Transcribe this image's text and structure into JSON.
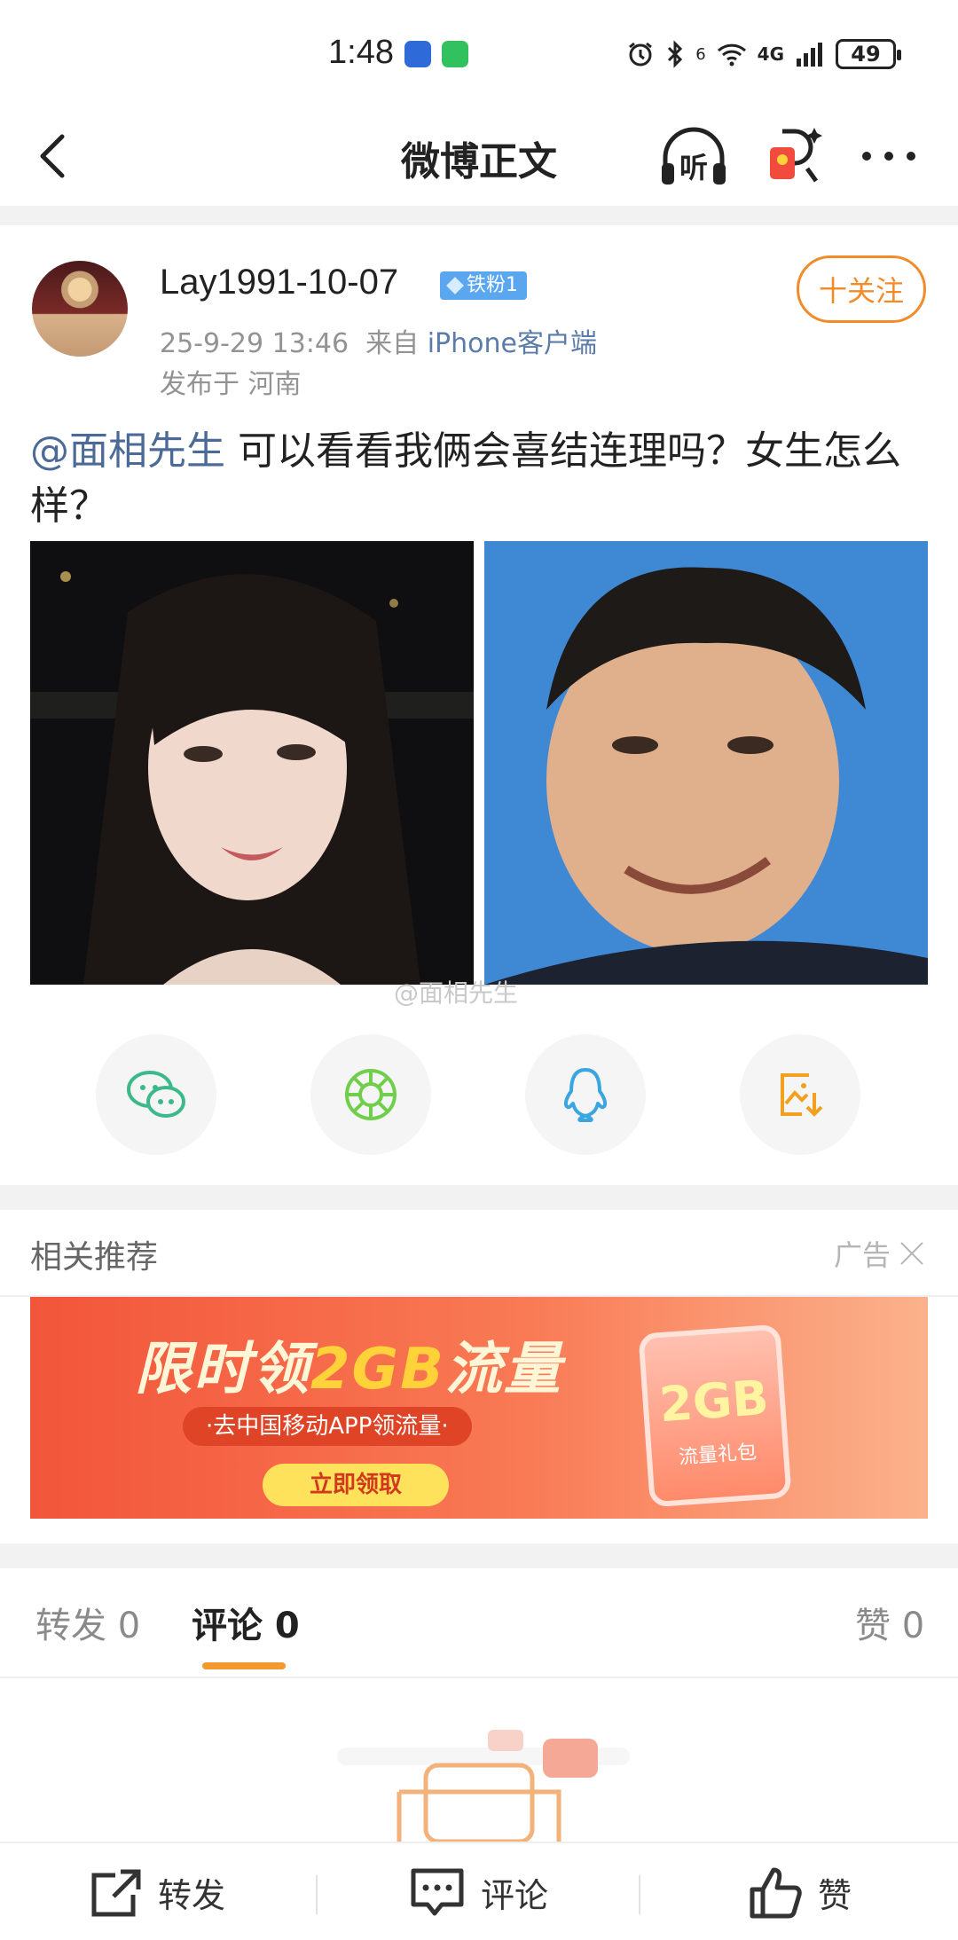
{
  "status_bar": {
    "time": "1:48",
    "network": "4G",
    "signal_prefix": "6",
    "battery": "49"
  },
  "nav": {
    "title": "微博正文",
    "listen_label": "听"
  },
  "post": {
    "author": "Lay1991-10-07",
    "fan_badge": "铁粉1",
    "timestamp": "25-9-29 13:46",
    "from_label": "来自",
    "source": "iPhone客户端",
    "location": "发布于 河南",
    "follow_label": "十关注",
    "mention": "@面相先生",
    "text": " 可以看看我俩会喜结连理吗？女生怎么样？",
    "watermark": "@面相先生"
  },
  "share": {
    "items": [
      "wechat-icon",
      "moments-icon",
      "qq-icon",
      "save-image-icon"
    ]
  },
  "related": {
    "title": "相关推荐",
    "ad_label": "广告",
    "ad": {
      "headline_prefix": "限时领",
      "headline_highlight": "2GB",
      "headline_suffix": "流量",
      "subtitle": "·去中国移动APP领流量·",
      "cta": "立即领取",
      "card_value": "2GB",
      "card_caption": "流量礼包"
    }
  },
  "tabs": {
    "repost": "转发 0",
    "comment": "评论 0",
    "like": "赞 0"
  },
  "bottom_bar": {
    "repost": "转发",
    "comment": "评论",
    "like": "赞"
  },
  "colors": {
    "accent": "#f28c2b",
    "link": "#4c6a98",
    "background_band": "#f2f2f2"
  }
}
